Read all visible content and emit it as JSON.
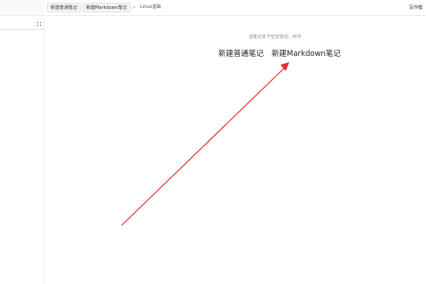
{
  "tabs": [
    {
      "label": "新建普通笔记"
    },
    {
      "label": "新建Markdown笔记"
    },
    {
      "label": "Linux基础"
    }
  ],
  "tab_separator": ">",
  "top_right": {
    "label": "写作模"
  },
  "main": {
    "hint": "请笔记本下空空如也...何不",
    "new_plain_note": "新建普通笔记",
    "new_markdown_note": "新建Markdown笔记"
  },
  "sidebar": {
    "grid_icon": "grid-icon"
  },
  "colors": {
    "arrow": "#e0302a"
  }
}
